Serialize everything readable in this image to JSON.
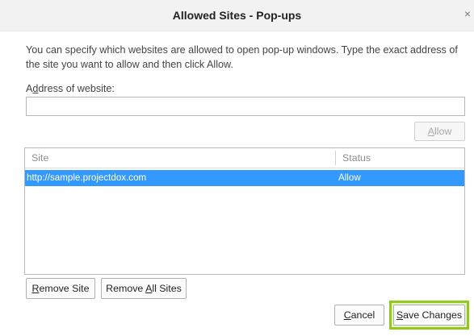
{
  "dialog": {
    "title": "Allowed Sites - Pop-ups",
    "close_glyph": "×",
    "description": "You can specify which websites are allowed to open pop-up windows. Type the exact address of the site you want to allow and then click Allow.",
    "address_label_accesskey": "d",
    "address_label_pre": "A",
    "address_label_post": "dress of website:",
    "address_value": "",
    "allow_label_accesskey": "A",
    "allow_label_rest": "llow"
  },
  "table": {
    "columns": [
      "Site",
      "Status"
    ],
    "rows": [
      {
        "site": "http://sample.projectdox.com",
        "status": "Allow",
        "selected": true
      }
    ]
  },
  "buttons": {
    "remove_site_key": "R",
    "remove_site_rest": "emove Site",
    "remove_all_pre": "Remove ",
    "remove_all_key": "A",
    "remove_all_rest": "ll Sites",
    "cancel_key": "C",
    "cancel_rest": "ancel",
    "save_key": "S",
    "save_rest": "ave Changes"
  },
  "colors": {
    "selection": "#3399ff",
    "highlight_border": "#93c81c"
  }
}
